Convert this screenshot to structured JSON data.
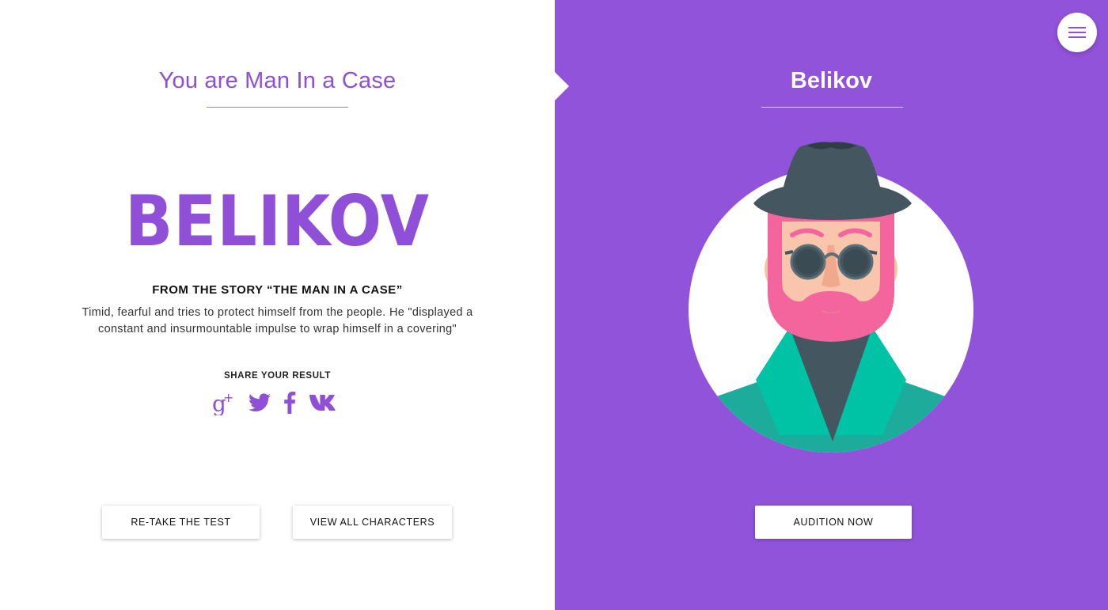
{
  "result": {
    "heading": "You are Man In a Case",
    "character_name_big": "BELIKOV",
    "story_title": "FROM THE STORY “THE MAN IN A CASE”",
    "description": "Timid, fearful and tries to protect himself from the people. He \"displayed a constant and insurmountable impulse to wrap himself in a covering\""
  },
  "share": {
    "label": "SHARE YOUR RESULT",
    "networks": [
      "google-plus",
      "twitter",
      "facebook",
      "vk"
    ]
  },
  "buttons": {
    "retake_label": "RE-TAKE THE TEST",
    "view_all_label": "VIEW ALL CHARACTERS",
    "audition_label": "AUDITION NOW"
  },
  "character": {
    "name": "Belikov"
  },
  "colors": {
    "accent": "#8f4fd6",
    "panel": "#9053d9",
    "white": "#ffffff"
  }
}
